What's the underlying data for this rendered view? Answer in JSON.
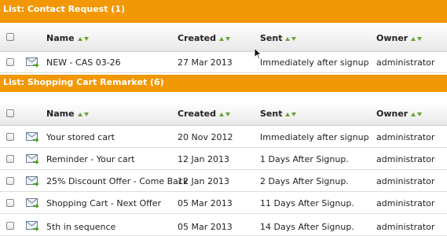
{
  "lists": [
    {
      "title": "List: Contact Request (1)",
      "columns": [
        "Name",
        "Created",
        "Sent",
        "Owner"
      ],
      "rows": [
        {
          "name": "NEW - CAS 03-26",
          "created": "27 Mar 2013",
          "sent": "Immediately after signup",
          "owner": "administrator"
        }
      ]
    },
    {
      "title": "List: Shopping Cart Remarket (6)",
      "columns": [
        "Name",
        "Created",
        "Sent",
        "Owner"
      ],
      "rows": [
        {
          "name": "Your stored cart",
          "created": "20 Nov 2012",
          "sent": "Immediately after signup",
          "owner": "administrator"
        },
        {
          "name": "Reminder - Your cart",
          "created": "12 Jan 2013",
          "sent": "1 Days After Signup.",
          "owner": "administrator"
        },
        {
          "name": "25% Discount Offer - Come Back",
          "created": "12 Jan 2013",
          "sent": "2 Days After Signup.",
          "owner": "administrator"
        },
        {
          "name": "Shopping Cart - Next Offer",
          "created": "05 Mar 2013",
          "sent": "11 Days After Signup.",
          "owner": "administrator"
        },
        {
          "name": "5th in sequence",
          "created": "05 Mar 2013",
          "sent": "14 Days After Signup.",
          "owner": "administrator"
        }
      ]
    }
  ],
  "icons": {
    "row_icon": "email-send-icon",
    "sort_icon": "sort-arrows-icon",
    "cursor": "mouse-pointer-icon"
  },
  "colors": {
    "list_header_bg": "#f29807",
    "sort_arrow": "#6aa233"
  }
}
